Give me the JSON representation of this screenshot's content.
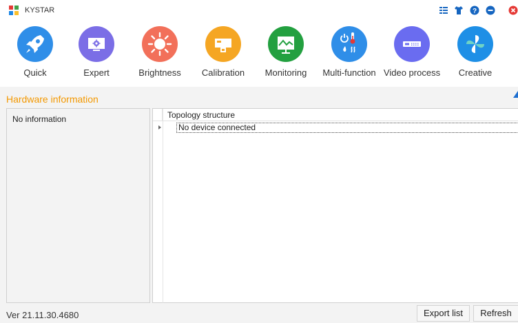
{
  "window": {
    "title": "KYSTAR"
  },
  "title_icons": [
    "layout-icon",
    "skin-tshirt-icon",
    "help-icon",
    "minimize-icon",
    "close-icon"
  ],
  "toolbar": {
    "items": [
      {
        "label": "Quick",
        "icon": "rocket-icon",
        "color": "#2f8ee8"
      },
      {
        "label": "Expert",
        "icon": "monitor-gear-icon",
        "color": "#7b6ee6"
      },
      {
        "label": "Brightness",
        "icon": "sun-icon",
        "color": "#f2705a"
      },
      {
        "label": "Calibration",
        "icon": "calibration-screen-icon",
        "color": "#f5a623"
      },
      {
        "label": "Monitoring",
        "icon": "monitor-chart-icon",
        "color": "#23a040"
      },
      {
        "label": "Multi-function",
        "icon": "power-thermo-icon",
        "color": "#2f8ee8"
      },
      {
        "label": "Video process",
        "icon": "video-processor-icon",
        "color": "#6a6cf0"
      },
      {
        "label": "Creative",
        "icon": "pinwheel-icon",
        "color": "#1e8fe6"
      }
    ]
  },
  "hardware": {
    "title": "Hardware information",
    "left_text": "No information",
    "tree": {
      "header": "Topology structure",
      "rows": [
        "No device connected"
      ]
    }
  },
  "status": {
    "version": "Ver 21.11.30.4680",
    "export_label": "Export list",
    "refresh_label": "Refresh"
  },
  "colors": {
    "accent_orange": "#f39800"
  }
}
